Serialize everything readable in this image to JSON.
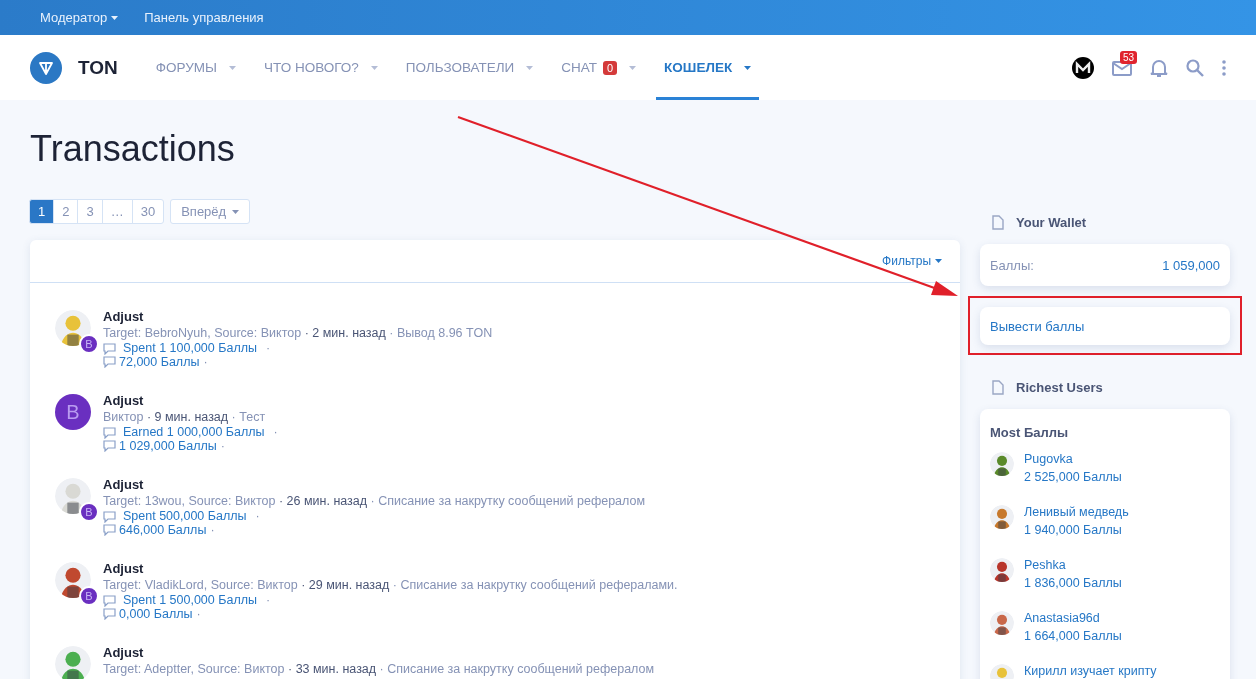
{
  "top_bar": {
    "items": [
      {
        "label": "Модератор",
        "dropdown": true
      },
      {
        "label": "Панель управления",
        "dropdown": false
      }
    ]
  },
  "header": {
    "logo_text": "TON",
    "nav": [
      {
        "label": "ФОРУМЫ",
        "selected": false
      },
      {
        "label": "ЧТО НОВОГО?",
        "selected": false
      },
      {
        "label": "ПОЛЬЗОВАТЕЛИ",
        "selected": false
      },
      {
        "label": "CHAT",
        "selected": false,
        "badge": "0"
      },
      {
        "label": "КОШЕЛЕК",
        "selected": true
      }
    ],
    "inbox_badge": "53"
  },
  "page_title": "Transactions",
  "pagination": {
    "pages": [
      {
        "label": "1",
        "selected": true
      },
      {
        "label": "2",
        "selected": false
      },
      {
        "label": "3",
        "selected": false
      },
      {
        "label": "…",
        "selected": false
      },
      {
        "label": "30",
        "selected": false
      }
    ],
    "next": "Вперёд"
  },
  "filters": "Фильтры",
  "separator": "·",
  "transactions": [
    {
      "title": "Adjust",
      "badge": "В",
      "source": "Target: BebroNyuh, Source: Виктор",
      "time": "2 мин. назад",
      "note": "Вывод 8.96 TON",
      "amount": "Spent 1 100,000 Баллы",
      "balance": "72,000 Баллы"
    },
    {
      "title": "Adjust",
      "avatar": {
        "kind": "letter",
        "letter": "В"
      },
      "source": "Виктор",
      "time": "9 мин. назад",
      "note": "Тест",
      "amount": "Earned 1 000,000 Баллы",
      "balance": "1 029,000 Баллы"
    },
    {
      "title": "Adjust",
      "badge": "В",
      "source": "Target: 13wou, Source: Виктор",
      "time": "26 мин. назад",
      "note": "Списание за накрутку сообщений рефералом",
      "amount": "Spent 500,000 Баллы",
      "balance": "646,000 Баллы"
    },
    {
      "title": "Adjust",
      "badge": "В",
      "source": "Target: VladikLord, Source: Виктор",
      "time": "29 мин. назад",
      "note": "Списание за накрутку сообщений рефералами.",
      "amount": "Spent 1 500,000 Баллы",
      "balance": "0,000 Баллы"
    },
    {
      "title": "Adjust",
      "source": "Target: Adeptter, Source: Виктор",
      "time": "33 мин. назад",
      "note": "Списание за накрутку сообщений рефералом"
    }
  ],
  "wallet": {
    "heading": "Your Wallet",
    "label": "Баллы:",
    "value": "1 059,000",
    "withdraw": {
      "label": "Вывести баллы",
      "highlighted": true
    }
  },
  "richest": {
    "heading": "Richest Users",
    "title": "Most Баллы",
    "users": [
      {
        "name": "Pugovka",
        "amount": "2 525,000 Баллы"
      },
      {
        "name": "Ленивый медведь",
        "amount": "1 940,000 Баллы"
      },
      {
        "name": "Peshka",
        "amount": "1 836,000 Баллы"
      },
      {
        "name": "Anastasia96d",
        "amount": "1 664,000 Баллы"
      },
      {
        "name": "Кирилл изучает крипту"
      }
    ]
  }
}
